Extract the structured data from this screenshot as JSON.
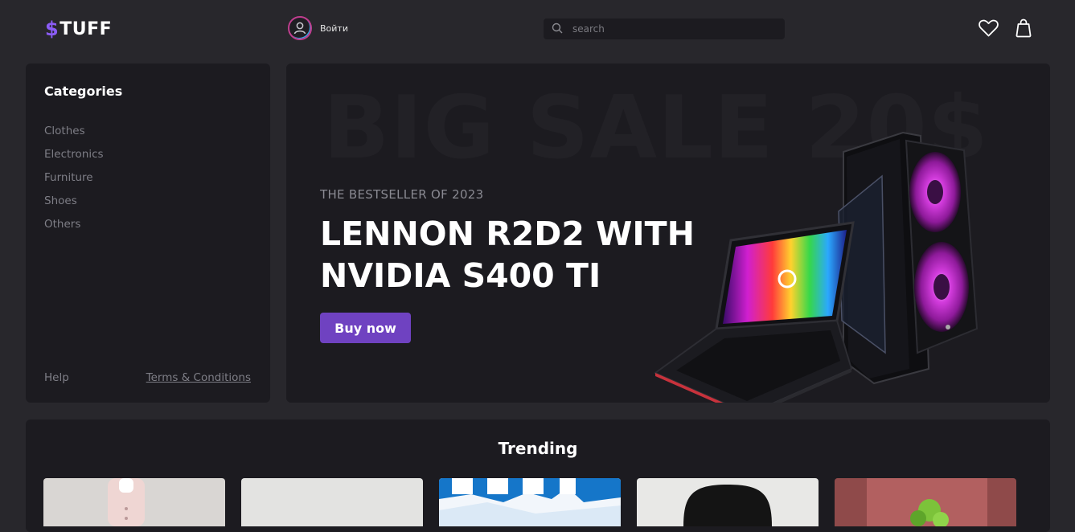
{
  "header": {
    "logo_symbol": "$",
    "logo_text": "TUFF",
    "user_label": "Войти",
    "search_placeholder": "search"
  },
  "sidebar": {
    "title": "Categories",
    "categories": [
      "Clothes",
      "Electronics",
      "Furniture",
      "Shoes",
      "Others"
    ],
    "help_label": "Help",
    "terms_label": "Terms & Conditions"
  },
  "banner": {
    "background_text": "BIG SALE 20$",
    "subtitle": "THE BESTSELLER OF 2023",
    "title": "LENNON R2D2 WITH NVIDIA S400 TI",
    "button_label": "Buy now"
  },
  "trending": {
    "title": "Trending"
  },
  "colors": {
    "accent": "#6f42c1",
    "logo_accent": "#8b5cf6",
    "panel": "#1c1b20",
    "page_bg": "#28272c"
  }
}
